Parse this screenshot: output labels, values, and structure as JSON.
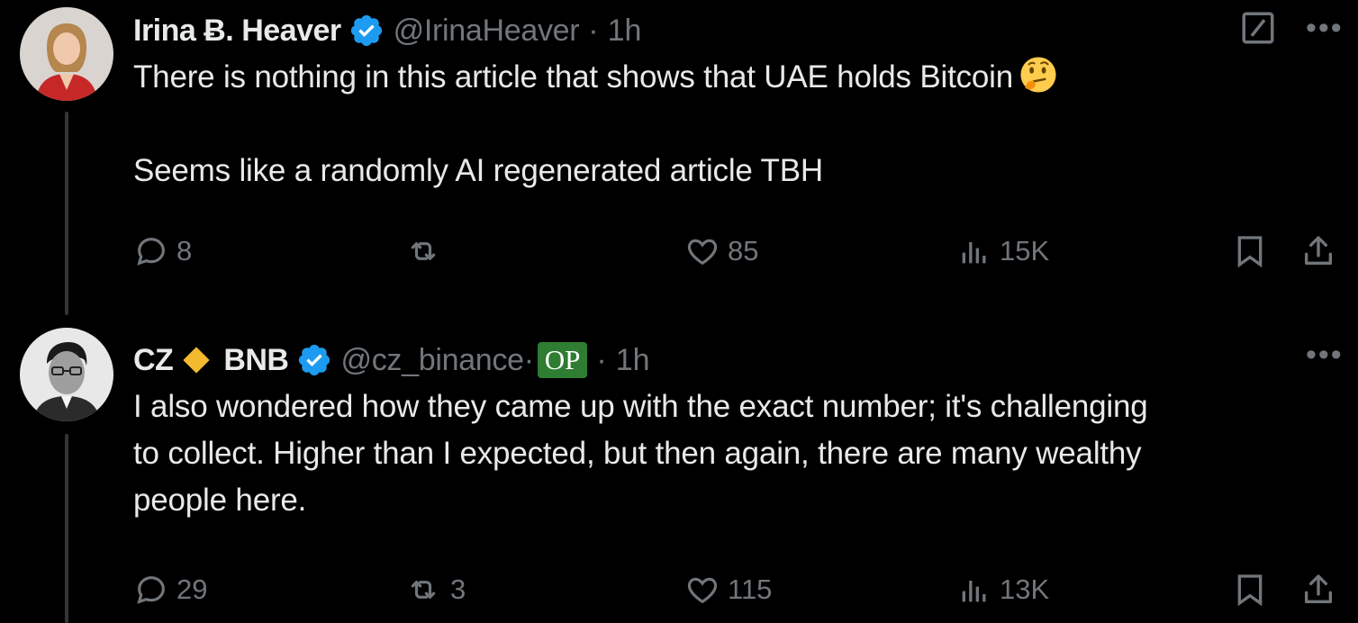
{
  "tweets": [
    {
      "name": "Irina Ƀ. Heaver",
      "handle": "@IrinaHeaver",
      "sep": "·",
      "time": "1h",
      "text_line1": "There is nothing in this article that shows that UAE holds Bitcoin",
      "text_para2": "Seems like a randomly AI regenerated article TBH",
      "emoji_icon": "thinking-face-icon",
      "replies": "8",
      "retweets": "",
      "likes": "85",
      "views": "15K",
      "more": "•••"
    },
    {
      "name_part1": "CZ",
      "name_part2": "BNB",
      "handle": "@cz_binance·",
      "op_badge": "OP",
      "sep": "·",
      "time": "1h",
      "text_lines": [
        "I also wondered how they came up with the exact number; it's challenging",
        "to collect. Higher than I expected, but then again, there are many wealthy",
        "people here."
      ],
      "replies": "29",
      "retweets": "3",
      "likes": "115",
      "views": "13K",
      "more": "•••"
    }
  ],
  "colors": {
    "background": "#000000",
    "text": "#e7e9ea",
    "muted": "#71767b",
    "verified": "#1d9bf0",
    "op_badge": "#2e7d32",
    "bnb_diamond": "#f3ba2f",
    "thread_line": "#333639"
  }
}
